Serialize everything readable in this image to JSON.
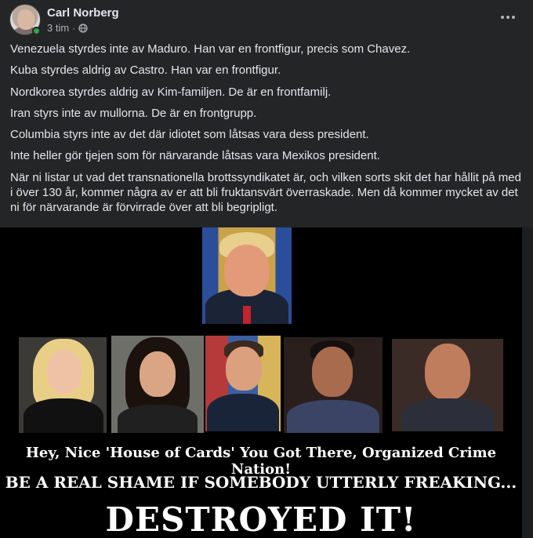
{
  "post": {
    "author": "Carl Norberg",
    "time": "3 tim",
    "separator": "·",
    "visibility_icon": "globe-icon",
    "more_icon": "more-options-icon",
    "paragraphs": [
      "Venezuela styrdes inte av Maduro. Han var en frontfigur, precis som Chavez.",
      "Kuba styrdes aldrig av Castro. Han var en frontfigur.",
      "Nordkorea styrdes aldrig av Kim-familjen. De är en frontfamilj.",
      "Iran styrs inte av mullorna. De är en frontgrupp.",
      "Columbia styrs inte av det där idiotet som låtsas vara dess president.",
      "Inte heller gör tjejen som för närvarande låtsas vara Mexikos president.",
      "När ni listar ut vad det transnationella brottssyndikatet är, och vilken sorts skit det har hållit på med i över 130 år, kommer några av er att bli fruktansvärt överraskade. Men då kommer mycket av det ni för närvarande är förvirrade över att bli begripligt."
    ]
  },
  "image": {
    "caption_line1": "Hey, Nice 'House of Cards' You Got There, Organized Crime Nation!",
    "caption_line2": "BE A REAL SHAME IF SOMEBODY UTTERLY FREAKING...",
    "caption_line3": "DESTROYED IT!"
  },
  "colors": {
    "background": "#242526",
    "text": "#e4e6eb",
    "secondary_text": "#b0b3b8",
    "online": "#31a24c"
  }
}
